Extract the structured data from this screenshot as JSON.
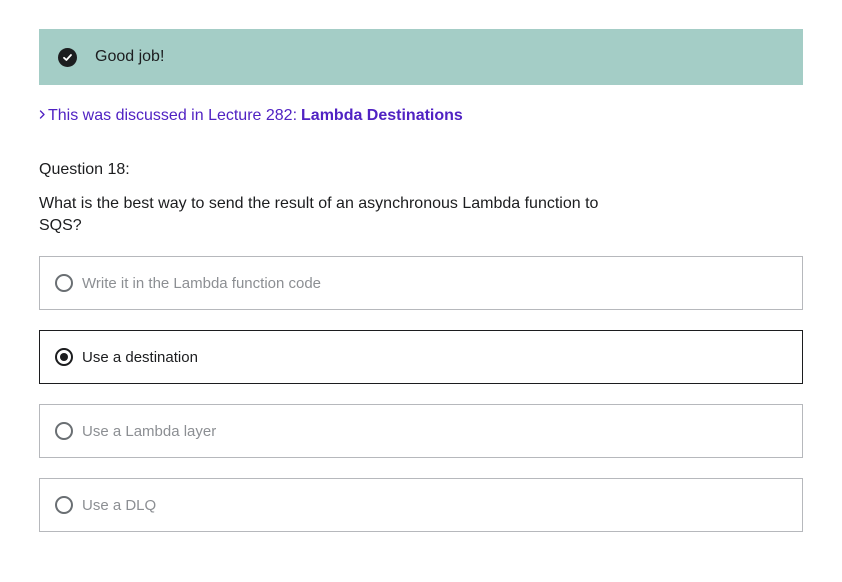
{
  "feedback": {
    "icon": "check-circle-icon",
    "message": "Good job!",
    "color": "#a4cdc6"
  },
  "reference": {
    "prefix": "This was discussed in Lecture 282:",
    "lecture_title": "Lambda Destinations",
    "color": "#5022c3"
  },
  "question": {
    "number_label": "Question 18:",
    "text": "What is the best way to send the result of an asynchronous Lambda function to SQS?"
  },
  "options": [
    {
      "label": "Write it in the Lambda function code",
      "selected": false
    },
    {
      "label": "Use a destination",
      "selected": true
    },
    {
      "label": "Use a Lambda layer",
      "selected": false
    },
    {
      "label": "Use a DLQ",
      "selected": false
    }
  ]
}
